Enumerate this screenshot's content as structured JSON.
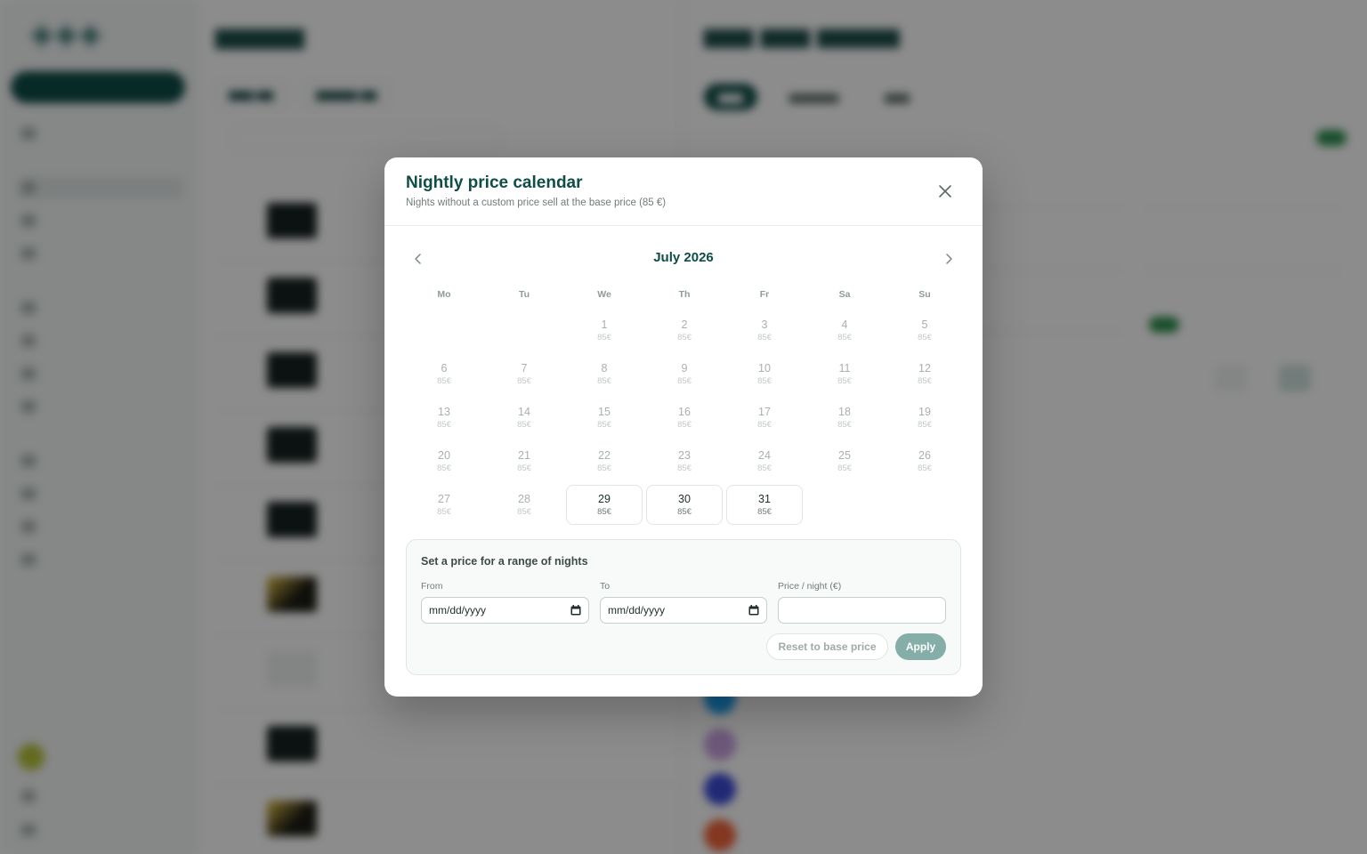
{
  "modal": {
    "title": "Nightly price calendar",
    "subtitle": "Nights without a custom price sell at the base price (85 €)",
    "close_icon": "close-icon"
  },
  "calendar": {
    "month_label": "July 2026",
    "prev_icon": "chevron-left-icon",
    "next_icon": "chevron-right-icon",
    "weekdays": [
      "Mo",
      "Tu",
      "We",
      "Th",
      "Fr",
      "Sa",
      "Su"
    ],
    "leading_blank_days": 2,
    "price_label": "85€",
    "days": [
      {
        "n": "1",
        "state": "past"
      },
      {
        "n": "2",
        "state": "past"
      },
      {
        "n": "3",
        "state": "past"
      },
      {
        "n": "4",
        "state": "past"
      },
      {
        "n": "5",
        "state": "past"
      },
      {
        "n": "6",
        "state": "past"
      },
      {
        "n": "7",
        "state": "past"
      },
      {
        "n": "8",
        "state": "past"
      },
      {
        "n": "9",
        "state": "past"
      },
      {
        "n": "10",
        "state": "past"
      },
      {
        "n": "11",
        "state": "past"
      },
      {
        "n": "12",
        "state": "past"
      },
      {
        "n": "13",
        "state": "past"
      },
      {
        "n": "14",
        "state": "past"
      },
      {
        "n": "15",
        "state": "past"
      },
      {
        "n": "16",
        "state": "past"
      },
      {
        "n": "17",
        "state": "past"
      },
      {
        "n": "18",
        "state": "past"
      },
      {
        "n": "19",
        "state": "past"
      },
      {
        "n": "20",
        "state": "past"
      },
      {
        "n": "21",
        "state": "past"
      },
      {
        "n": "22",
        "state": "past"
      },
      {
        "n": "23",
        "state": "past"
      },
      {
        "n": "24",
        "state": "past"
      },
      {
        "n": "25",
        "state": "past"
      },
      {
        "n": "26",
        "state": "past"
      },
      {
        "n": "27",
        "state": "past"
      },
      {
        "n": "28",
        "state": "past"
      },
      {
        "n": "29",
        "state": "open"
      },
      {
        "n": "30",
        "state": "open"
      },
      {
        "n": "31",
        "state": "open"
      }
    ]
  },
  "range_form": {
    "title": "Set a price for a range of nights",
    "from_label": "From",
    "from_value": "mm/dd/yyyy",
    "to_label": "To",
    "to_value": "mm/dd/yyyy",
    "price_label": "Price / night (€)",
    "price_value": "",
    "reset_label": "Reset to base price",
    "apply_label": "Apply"
  },
  "colors": {
    "brand": "#0f4d47",
    "apply_button": "#86aea8",
    "overlay": "#000000"
  }
}
